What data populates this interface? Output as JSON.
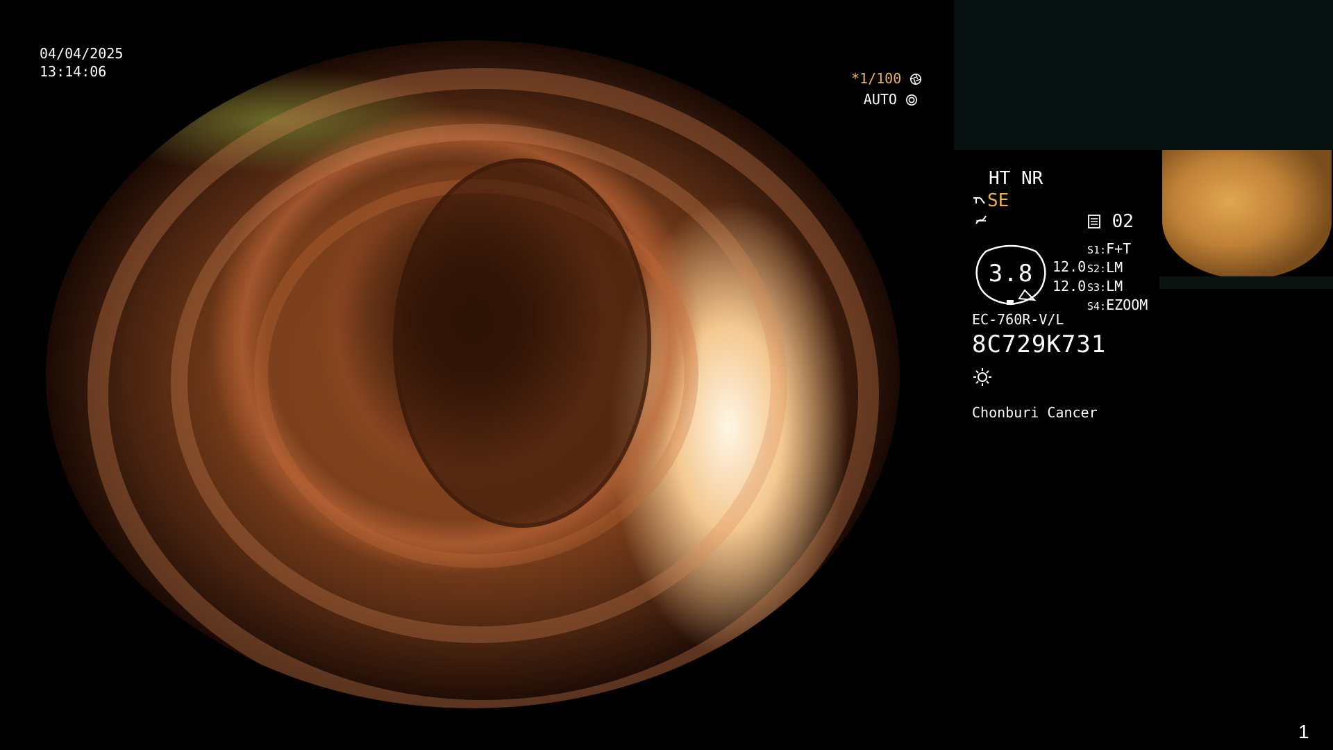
{
  "overlay": {
    "date": "04/04/2025",
    "time": "13:14:06",
    "shutter": "*1/100",
    "auto_label": "AUTO",
    "page_number": "1"
  },
  "settings": {
    "ht_nr": "HT NR",
    "se_label": "SE",
    "mode_code": "02",
    "zoom_value": "3.8",
    "value_a": "12.0",
    "value_b": "12.0",
    "s1_key": "S1:",
    "s1_val": "F+T",
    "s2_key": "S2:",
    "s2_val": "LM",
    "s3_key": "S3:",
    "s3_val": "LM",
    "s4_key": "S4:",
    "s4_val": "EZOOM",
    "scope_model": "EC-760R-V/L",
    "serial": "8C729K731",
    "institution": "Chonburi Cancer"
  },
  "colors": {
    "accent_yellow": "#f0b24a",
    "text": "#ffffff",
    "background": "#000000"
  },
  "icons": {
    "shutter": "aperture-icon",
    "auto": "iris-icon",
    "se": "enhancement-icon",
    "second": "filter-icon",
    "mode": "memory-icon",
    "light": "light-icon"
  }
}
